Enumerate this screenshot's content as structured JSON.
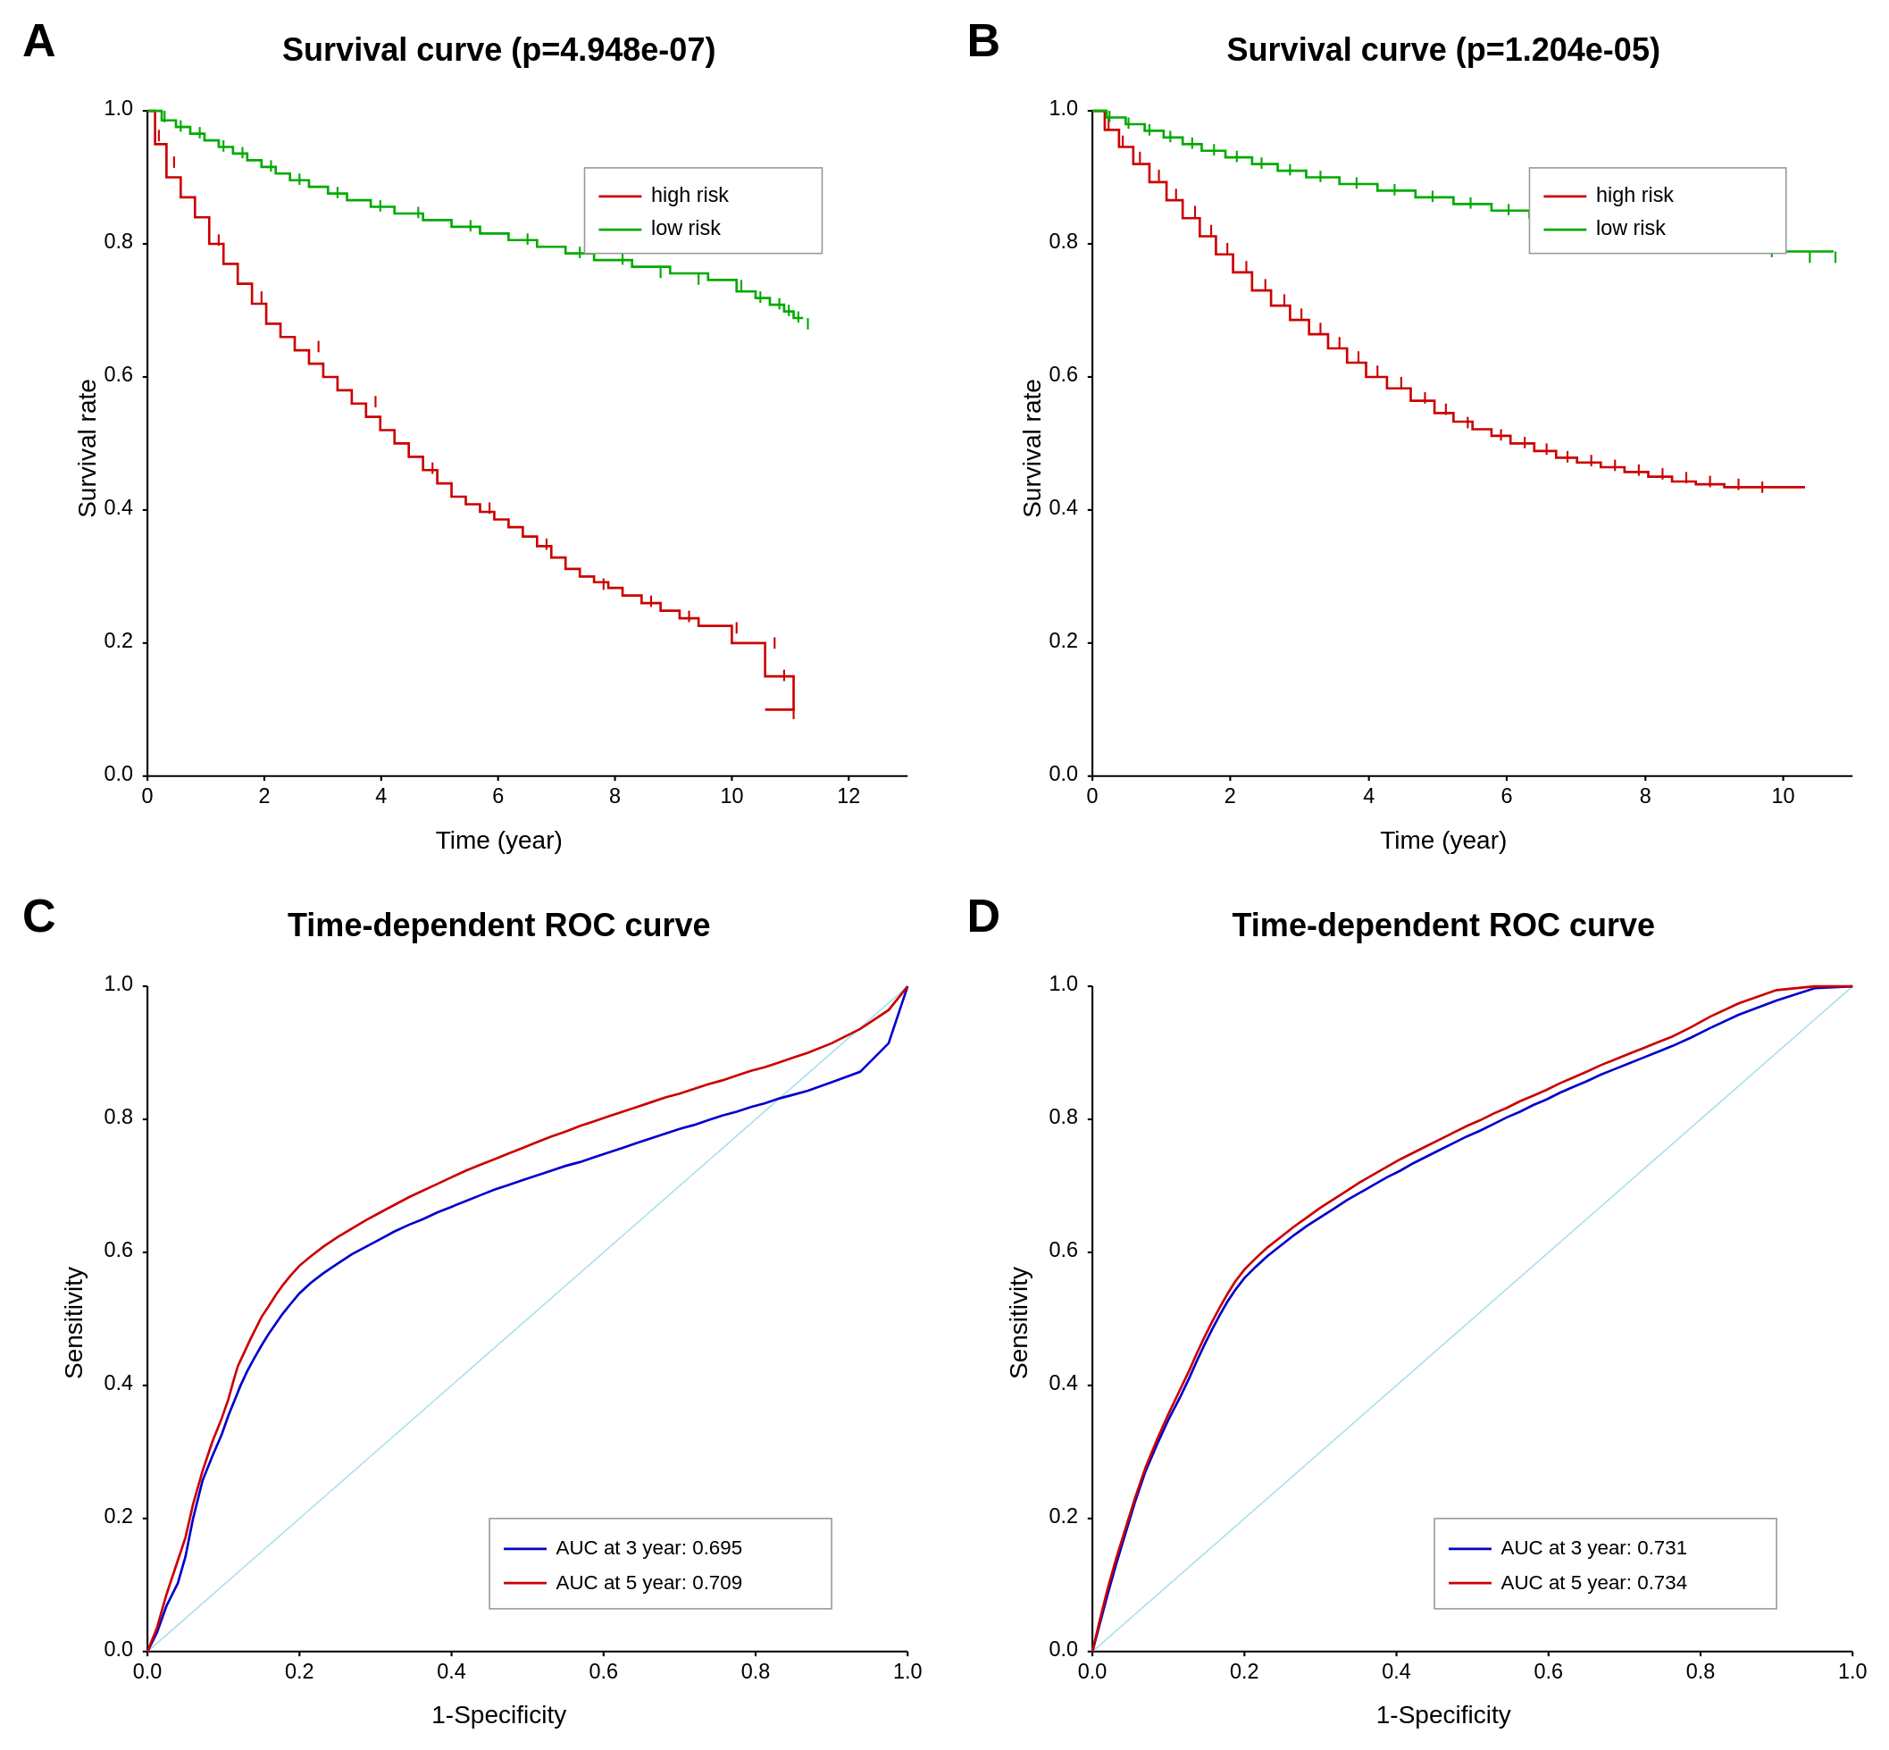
{
  "panels": {
    "A": {
      "label": "A",
      "title": "Survival curve (p=4.948e-07)",
      "x_label": "Time (year)",
      "y_label": "Survival rate",
      "x_ticks": [
        0,
        2,
        4,
        6,
        8,
        10,
        12
      ],
      "y_ticks": [
        0.0,
        0.2,
        0.4,
        0.6,
        0.8,
        1.0
      ],
      "x_max": 13,
      "legend": {
        "items": [
          {
            "label": "high risk",
            "color": "#cc0000"
          },
          {
            "label": "low risk",
            "color": "#00aa00"
          }
        ]
      }
    },
    "B": {
      "label": "B",
      "title": "Survival curve (p=1.204e-05)",
      "x_label": "Time (year)",
      "y_label": "Survival rate",
      "x_ticks": [
        0,
        2,
        4,
        6,
        8,
        10
      ],
      "y_ticks": [
        0.0,
        0.2,
        0.4,
        0.6,
        0.8,
        1.0
      ],
      "x_max": 11,
      "legend": {
        "items": [
          {
            "label": "high risk",
            "color": "#cc0000"
          },
          {
            "label": "low risk",
            "color": "#00aa00"
          }
        ]
      }
    },
    "C": {
      "label": "C",
      "title": "Time-dependent ROC curve",
      "x_label": "1-Specificity",
      "y_label": "Sensitivity",
      "x_ticks": [
        0.0,
        0.2,
        0.4,
        0.6,
        0.8,
        1.0
      ],
      "y_ticks": [
        0.0,
        0.2,
        0.4,
        0.6,
        0.8,
        1.0
      ],
      "legend": {
        "items": [
          {
            "label": "AUC at 3 year: 0.695",
            "color": "#0000cc"
          },
          {
            "label": "AUC at 5 year: 0.709",
            "color": "#cc0000"
          }
        ]
      }
    },
    "D": {
      "label": "D",
      "title": "Time-dependent ROC curve",
      "x_label": "1-Specificity",
      "y_label": "Sensitivity",
      "x_ticks": [
        0.0,
        0.2,
        0.4,
        0.6,
        0.8,
        1.0
      ],
      "y_ticks": [
        0.0,
        0.2,
        0.4,
        0.6,
        0.8,
        1.0
      ],
      "legend": {
        "items": [
          {
            "label": "AUC at 3 year: 0.731",
            "color": "#0000cc"
          },
          {
            "label": "AUC at 5 year: 0.734",
            "color": "#cc0000"
          }
        ]
      }
    }
  }
}
